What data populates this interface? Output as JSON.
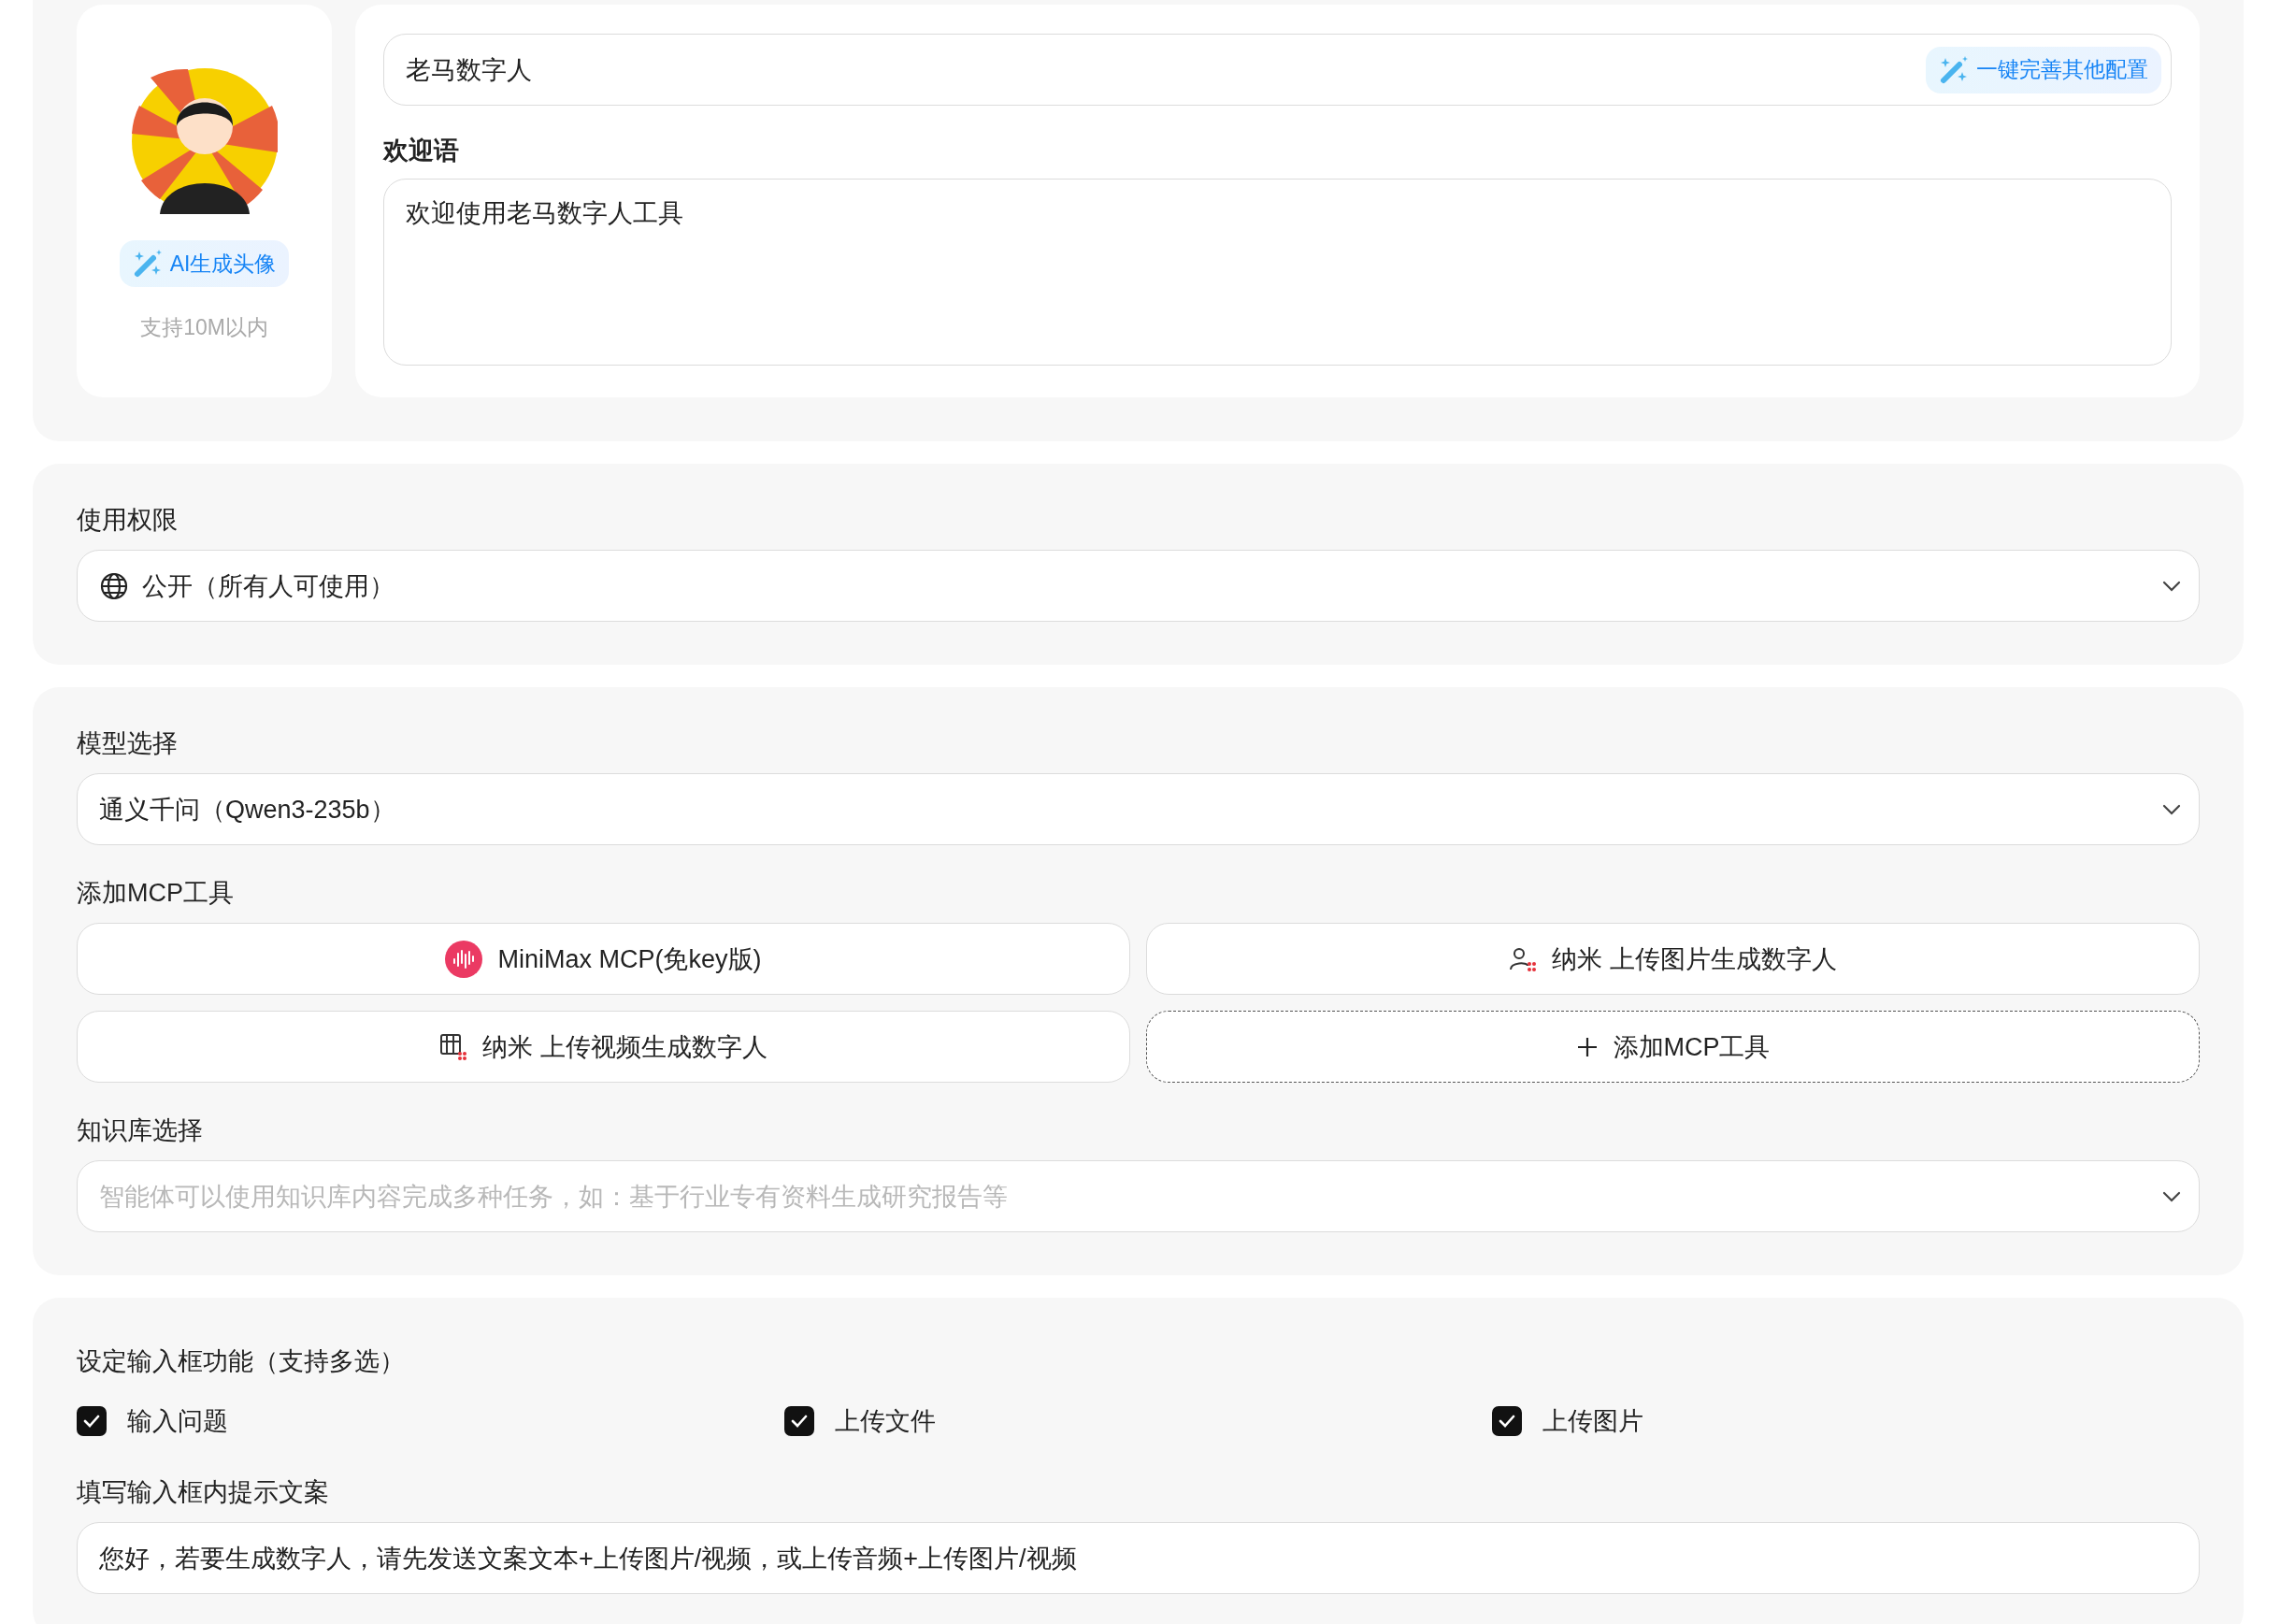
{
  "profile": {
    "avatar_button": "AI生成头像",
    "avatar_hint": "支持10M以内",
    "name": "老马数字人",
    "autofill_button": "一键完善其他配置",
    "welcome_label": "欢迎语",
    "welcome_text": "欢迎使用老马数字人工具"
  },
  "permission": {
    "label": "使用权限",
    "value": "公开（所有人可使用）"
  },
  "model": {
    "label": "模型选择",
    "value": "通义千问（Qwen3-235b）"
  },
  "mcp": {
    "label": "添加MCP工具",
    "tools": [
      {
        "kind": "minimax",
        "name": "MiniMax MCP(免key版)"
      },
      {
        "kind": "image",
        "name": "纳米 上传图片生成数字人"
      },
      {
        "kind": "video",
        "name": "纳米 上传视频生成数字人"
      }
    ],
    "add_button": "添加MCP工具"
  },
  "knowledge": {
    "label": "知识库选择",
    "placeholder": "智能体可以使用知识库内容完成多种任务，如：基于行业专有资料生成研究报告等"
  },
  "input_features": {
    "label": "设定输入框功能（支持多选）",
    "options": [
      {
        "label": "输入问题",
        "checked": true
      },
      {
        "label": "上传文件",
        "checked": true
      },
      {
        "label": "上传图片",
        "checked": true
      }
    ]
  },
  "hint_text": {
    "label": "填写输入框内提示文案",
    "value": "您好，若要生成数字人，请先发送文案文本+上传图片/视频，或上传音频+上传图片/视频"
  }
}
